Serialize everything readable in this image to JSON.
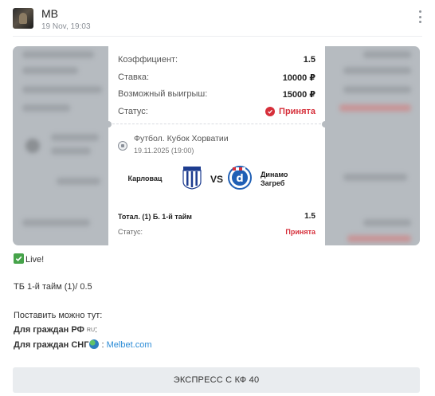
{
  "post": {
    "author": "MB",
    "date": "19 Nov, 19:03"
  },
  "ticket": {
    "rows": [
      {
        "label": "Коэффициент:",
        "value": "1.5"
      },
      {
        "label": "Ставка:",
        "value": "10000 ₽"
      },
      {
        "label": "Возможный выигрыш:",
        "value": "15000 ₽"
      }
    ],
    "status_label": "Статус:",
    "status_value": "Принята",
    "league": "Футбол. Кубок Хорватии",
    "match_date": "19.11.2025 (19:00)",
    "home_team": "Карловац",
    "vs": "VS",
    "away_team_line1": "Динамо",
    "away_team_line2": "Загреб",
    "bet_name": "Тотал. (1) Б. 1-й тайм",
    "bet_coef": "1.5",
    "bet_status_label": "Статус:",
    "bet_status_value": "Принята"
  },
  "message": {
    "live": "Live!",
    "bet": "ТБ 1-й тайм (1)/ 0.5",
    "place_here": "Поставить можно тут:",
    "rf_label": "Для граждан РФ",
    "rf_flag": "RU",
    "rf_suffix": ":",
    "cis_label": "Для граждан СНГ",
    "cis_suffix": ":",
    "cis_link": "Melbet.com"
  },
  "button": {
    "label": "ЭКСПРЕСС С КФ 40"
  },
  "colors": {
    "accent_red": "#d62f3a",
    "link_blue": "#2a8bd6",
    "check_green": "#46a34a"
  },
  "icons": {
    "menu": "three-dots-vertical-icon",
    "status": "checkmark-circle-icon",
    "sport": "football-icon",
    "live": "check-box-icon",
    "globe": "globe-icon"
  }
}
